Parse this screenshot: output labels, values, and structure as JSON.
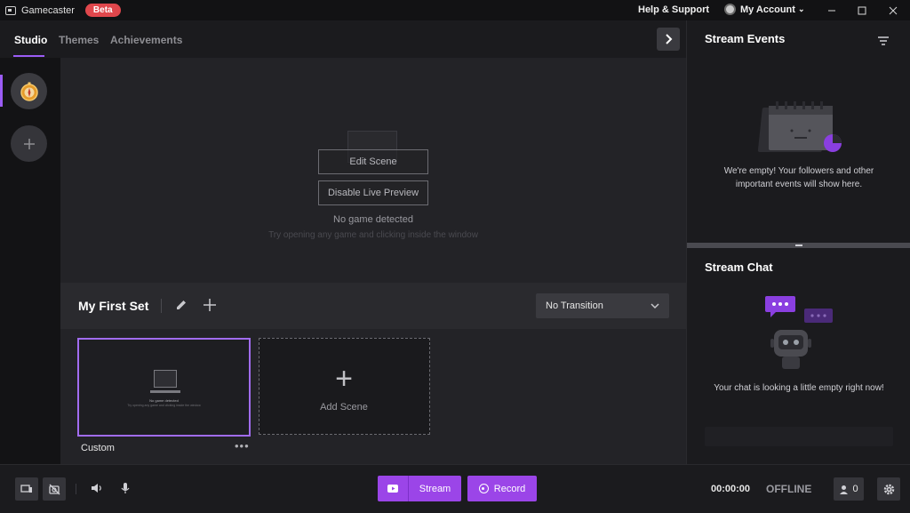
{
  "app": {
    "name": "Gamecaster",
    "badge": "Beta"
  },
  "titlebar": {
    "help": "Help & Support",
    "account": "My Account",
    "account_caret": "⌄"
  },
  "tabs": [
    {
      "label": "Studio"
    },
    {
      "label": "Themes"
    },
    {
      "label": "Achievements"
    }
  ],
  "preview": {
    "edit_scene": "Edit Scene",
    "disable_preview": "Disable Live Preview",
    "no_game": "No game detected",
    "hint": "Try opening any game and clicking inside the window"
  },
  "set": {
    "title": "My First Set",
    "transition": "No Transition"
  },
  "scenes": [
    {
      "name": "Custom",
      "thumb_title": "No game detected",
      "thumb_hint": "Try opening any game and clicking inside the window",
      "more": "•••"
    }
  ],
  "add_scene": {
    "plus": "+",
    "label": "Add Scene"
  },
  "bottom": {
    "stream": "Stream",
    "record": "Record",
    "timer": "00:00:00",
    "status": "OFFLINE",
    "viewers": "0"
  },
  "right": {
    "events_title": "Stream Events",
    "events_msg": "We're empty! Your followers and other important events will show here.",
    "chat_title": "Stream Chat",
    "chat_msg": "Your chat is looking a little empty right now!"
  },
  "colors": {
    "accent": "#9b45e8",
    "beta": "#e0474c",
    "highlight": "#9b5cf5"
  },
  "icons": {
    "rail_game": "compass-icon",
    "rail_add": "plus-icon",
    "collapse": "chevron-right-icon",
    "edit": "pencil-icon",
    "filter": "filter-icon",
    "settings": "gear-icon",
    "viewers": "user-icon"
  }
}
